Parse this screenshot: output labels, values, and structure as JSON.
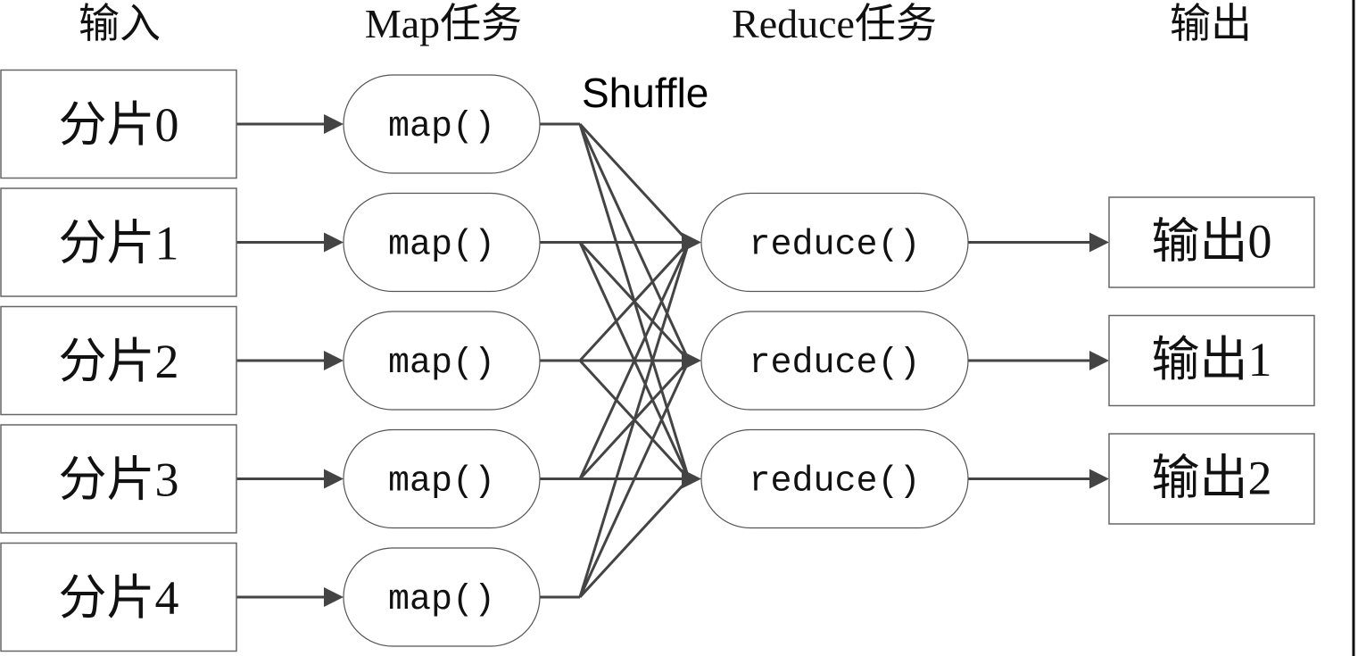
{
  "columns": {
    "input": "输入",
    "map": "Map任务",
    "reduce": "Reduce任务",
    "output": "输出"
  },
  "shuffle_label": "Shuffle",
  "inputs": [
    {
      "label": "分片0"
    },
    {
      "label": "分片1"
    },
    {
      "label": "分片2"
    },
    {
      "label": "分片3"
    },
    {
      "label": "分片4"
    }
  ],
  "maps": [
    {
      "label": "map()"
    },
    {
      "label": "map()"
    },
    {
      "label": "map()"
    },
    {
      "label": "map()"
    },
    {
      "label": "map()"
    }
  ],
  "reduces": [
    {
      "label": "reduce()"
    },
    {
      "label": "reduce()"
    },
    {
      "label": "reduce()"
    }
  ],
  "outputs": [
    {
      "label": "输出0"
    },
    {
      "label": "输出1"
    },
    {
      "label": "输出2"
    }
  ],
  "shuffle_edges": "all-to-all",
  "colors": {
    "edge": "#444444",
    "box_border": "#666666"
  }
}
